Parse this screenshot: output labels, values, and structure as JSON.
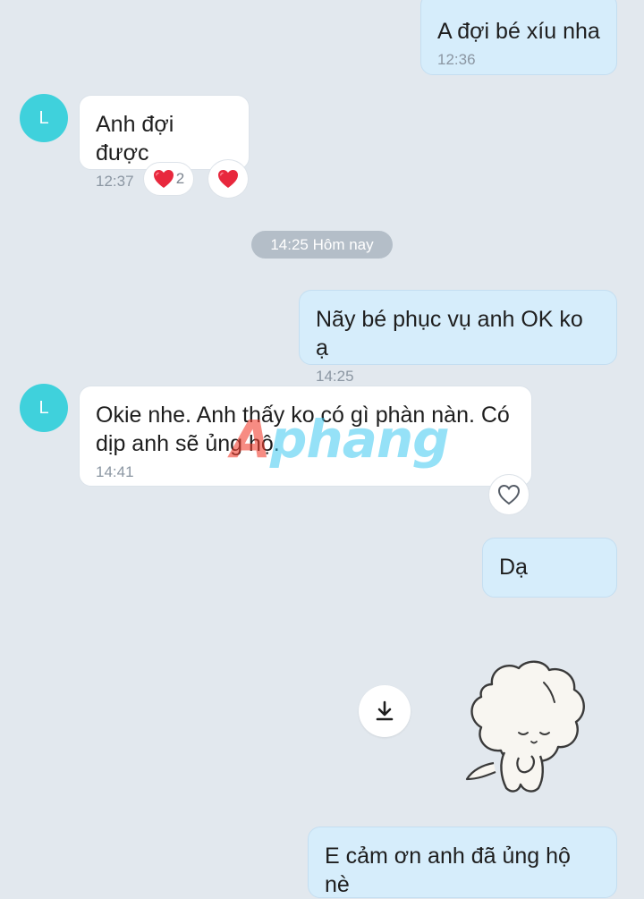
{
  "messages": [
    {
      "text": "A đợi bé xíu nha",
      "time": "12:36"
    },
    {
      "avatar_letter": "L",
      "text": "Anh đợi được",
      "time": "12:37",
      "reactions": [
        {
          "icon": "heart-icon",
          "count": "2"
        },
        {
          "icon": "heart-icon"
        }
      ]
    },
    {
      "text": "Nãy bé phục vụ anh OK ko ạ",
      "time": "14:25"
    },
    {
      "avatar_letter": "L",
      "text": "Okie nhe. Anh thấy ko có gì phàn nàn. Có dịp anh sẽ ủng hộ.",
      "time": "14:41"
    },
    {
      "text": "Dạ"
    },
    {
      "text": "E cảm ơn anh đã ủng hộ nè"
    }
  ],
  "date_separator": "14:25 Hôm nay",
  "watermark": {
    "first": "A",
    "rest": "phang"
  },
  "icons": {
    "reaction": "heart-icon",
    "like": "heart-outline-icon",
    "download": "download-icon",
    "sticker": "sticker-image"
  },
  "colors": {
    "outgoing_bubble": "#d6edfb",
    "incoming_bubble": "#ffffff",
    "avatar": "#3fd1dc",
    "background": "#e2e8ee",
    "heart": "#e8283d"
  }
}
